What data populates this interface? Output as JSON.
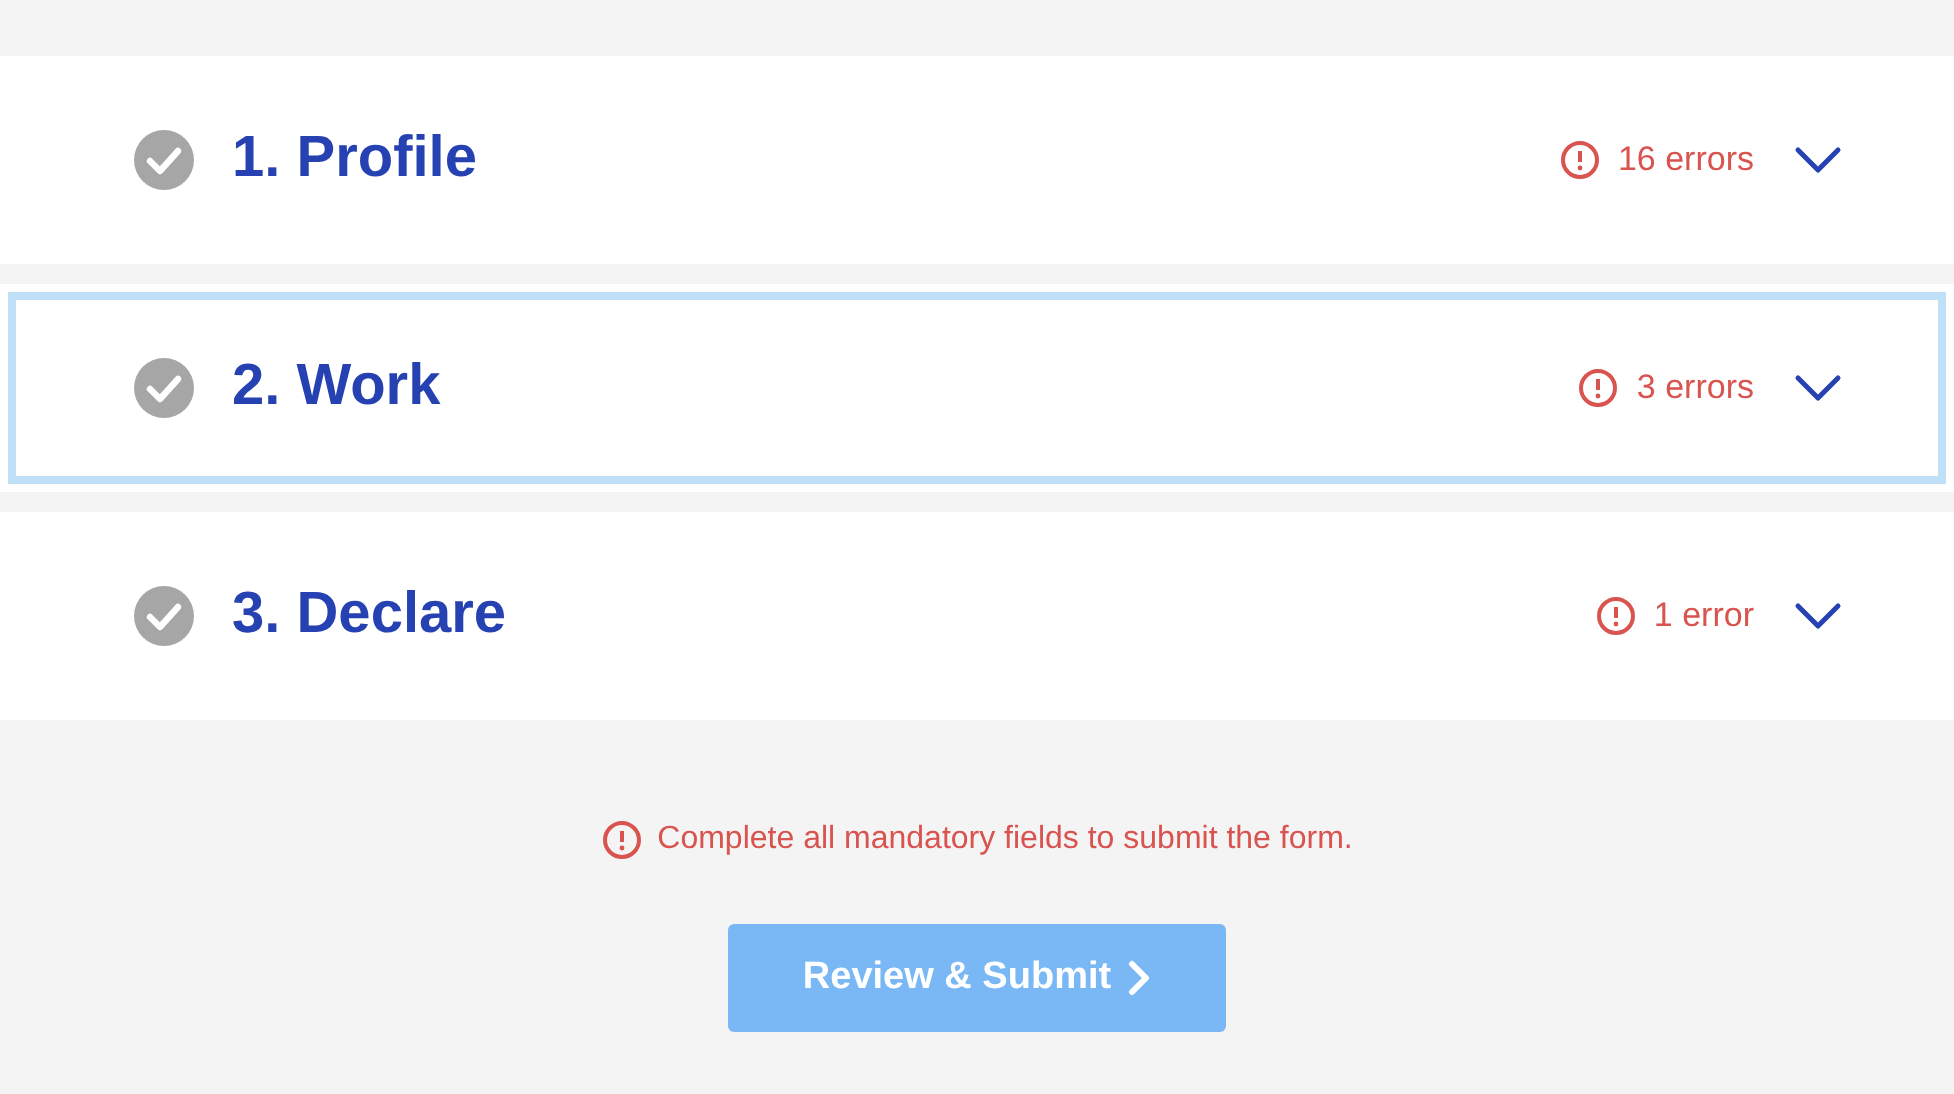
{
  "sections": [
    {
      "title": "1. Profile",
      "complete": true,
      "errors": "16 errors",
      "selected": false
    },
    {
      "title": "2. Work",
      "complete": true,
      "errors": "3 errors",
      "selected": true
    },
    {
      "title": "3. Declare",
      "complete": true,
      "errors": "1 error",
      "selected": false
    }
  ],
  "message": "Complete all mandatory fields to submit the form.",
  "submit_button": {
    "label": "Review & Submit",
    "disabled": true
  }
}
